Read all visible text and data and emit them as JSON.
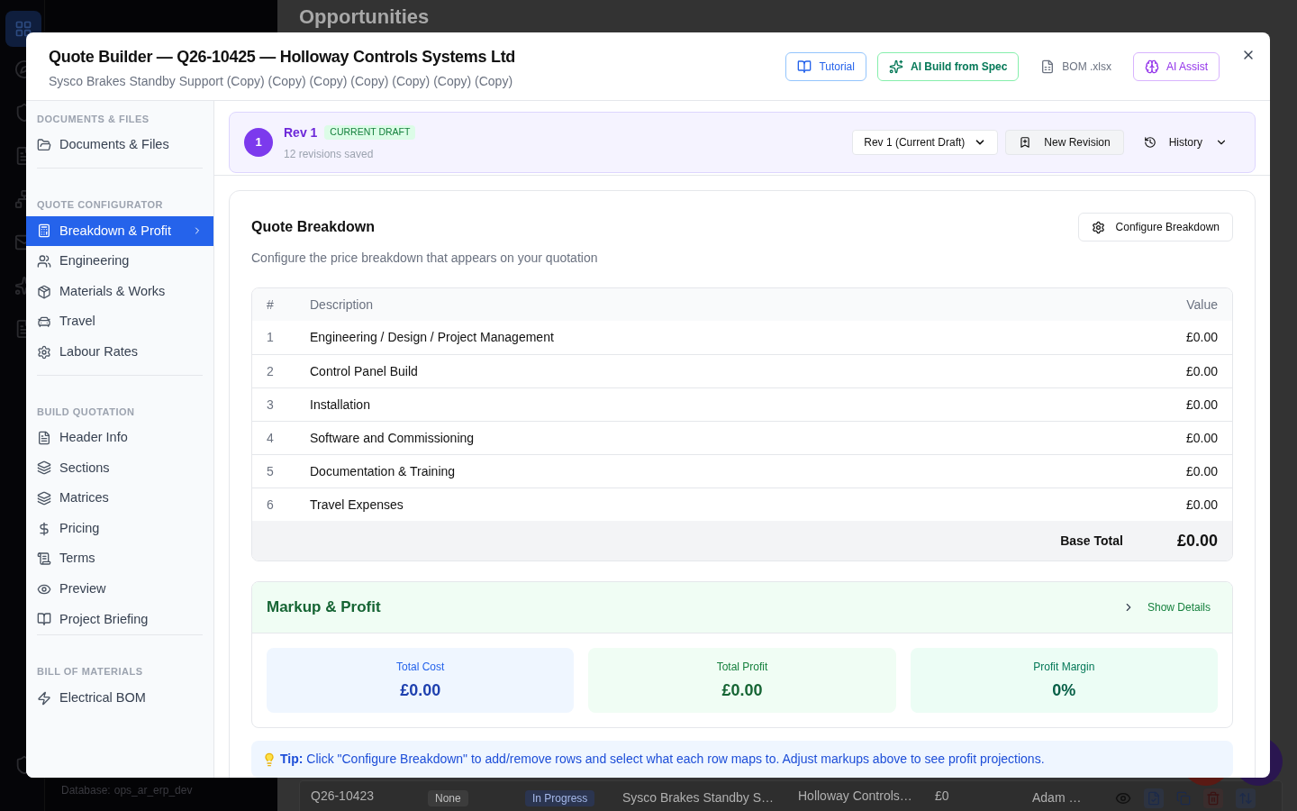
{
  "background": {
    "heading": "Opportunities",
    "database_label": "Database:",
    "database_value": "ops_ar_erp_dev",
    "row": {
      "id": "Q26-10423",
      "priority": "None",
      "status": "In Progress",
      "title": "Sysco Brakes Standby S…",
      "customer": "Holloway Controls…",
      "value": "£0",
      "owner": "Adam …"
    }
  },
  "modal": {
    "title": "Quote Builder — Q26-10425 — Holloway Controls Systems Ltd",
    "subtitle": "Sysco Brakes Standby Support (Copy) (Copy) (Copy) (Copy) (Copy) (Copy) (Copy)",
    "actions": [
      {
        "kind": "tutorial",
        "label": "Tutorial"
      },
      {
        "kind": "ai_build",
        "label": "AI Build from Spec"
      },
      {
        "kind": "bom",
        "label": "BOM .xlsx"
      },
      {
        "kind": "ai_assist",
        "label": "AI Assist"
      }
    ]
  },
  "sidebar": {
    "sections": [
      {
        "title": "DOCUMENTS & FILES",
        "items": [
          {
            "label": "Documents & Files",
            "selected": false
          }
        ]
      },
      {
        "title": "QUOTE CONFIGURATOR",
        "items": [
          {
            "label": "Breakdown & Profit",
            "selected": true
          },
          {
            "label": "Engineering",
            "selected": false
          },
          {
            "label": "Materials & Works",
            "selected": false
          },
          {
            "label": "Travel",
            "selected": false
          },
          {
            "label": "Labour Rates",
            "selected": false
          }
        ]
      },
      {
        "title": "BUILD QUOTATION",
        "items": [
          {
            "label": "Header Info",
            "selected": false
          },
          {
            "label": "Sections",
            "selected": false
          },
          {
            "label": "Matrices",
            "selected": false
          },
          {
            "label": "Pricing",
            "selected": false
          },
          {
            "label": "Terms",
            "selected": false
          },
          {
            "label": "Preview",
            "selected": false
          },
          {
            "label": "Project Briefing",
            "selected": false
          }
        ]
      },
      {
        "title": "BILL OF MATERIALS",
        "items": [
          {
            "label": "Electrical BOM",
            "selected": false
          }
        ]
      }
    ]
  },
  "revision": {
    "number": "1",
    "label": "Rev 1",
    "badge": "CURRENT DRAFT",
    "saved": "12 revisions saved",
    "select_value": "Rev 1 (Current Draft)",
    "new_revision": "New Revision",
    "history": "History"
  },
  "breakdown": {
    "title": "Quote Breakdown",
    "description": "Configure the price breakdown that appears on your quotation",
    "configure": "Configure Breakdown",
    "columns": [
      "#",
      "Description",
      "Value"
    ],
    "rows": [
      {
        "num": "1",
        "description": "Engineering / Design / Project Management",
        "value": "£0.00"
      },
      {
        "num": "2",
        "description": "Control Panel Build",
        "value": "£0.00"
      },
      {
        "num": "3",
        "description": "Installation",
        "value": "£0.00"
      },
      {
        "num": "4",
        "description": "Software and Commissioning",
        "value": "£0.00"
      },
      {
        "num": "5",
        "description": "Documentation & Training",
        "value": "£0.00"
      },
      {
        "num": "6",
        "description": "Travel Expenses",
        "value": "£0.00"
      }
    ],
    "total_label": "Base Total",
    "total_value": "£0.00"
  },
  "markup": {
    "title": "Markup & Profit",
    "expanded": false,
    "toggle": "Show Details",
    "stats": [
      {
        "kind": "cost",
        "label": "Total Cost",
        "value": "£0.00"
      },
      {
        "kind": "profit",
        "label": "Total Profit",
        "value": "£0.00"
      },
      {
        "kind": "margin",
        "label": "Profit Margin",
        "value": "0%"
      }
    ]
  },
  "tip": {
    "text": "**Tip:** Click \"Configure Breakdown\" to add/remove rows and select what each row maps to. Adjust markups above to see profit projections."
  }
}
